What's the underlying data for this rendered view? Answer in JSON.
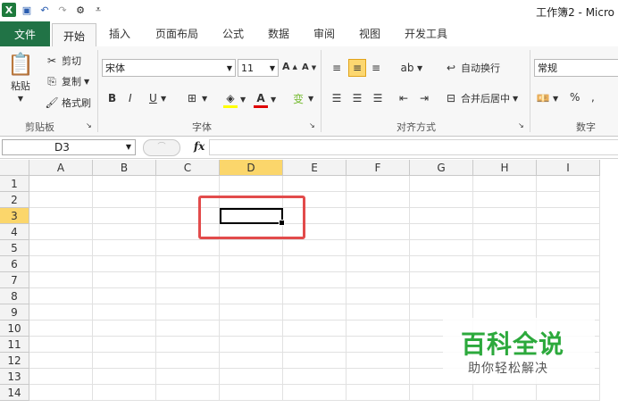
{
  "title": "工作簿2 - Micro",
  "tabs": [
    "文件",
    "开始",
    "插入",
    "页面布局",
    "公式",
    "数据",
    "审阅",
    "视图",
    "开发工具"
  ],
  "clipboard": {
    "paste": "粘贴",
    "cut": "剪切",
    "copy": "复制",
    "format_painter": "格式刷",
    "label": "剪贴板"
  },
  "font": {
    "name": "宋体",
    "size": "11",
    "bold": "B",
    "italic": "I",
    "underline": "U",
    "label": "字体"
  },
  "align": {
    "wrap": "自动换行",
    "merge": "合并后居中",
    "label": "对齐方式"
  },
  "number": {
    "format": "常规",
    "percent": "%",
    "comma": ",",
    "label": "数字"
  },
  "namebox": "D3",
  "fx": "fx",
  "columns": [
    "A",
    "B",
    "C",
    "D",
    "E",
    "F",
    "G",
    "H",
    "I"
  ],
  "rows": [
    "1",
    "2",
    "3",
    "4",
    "5",
    "6",
    "7",
    "8",
    "9",
    "10",
    "11",
    "12",
    "13",
    "14"
  ],
  "active_cell": "D3",
  "watermark": {
    "title": "百科全说",
    "subtitle": "助你轻松解决"
  }
}
